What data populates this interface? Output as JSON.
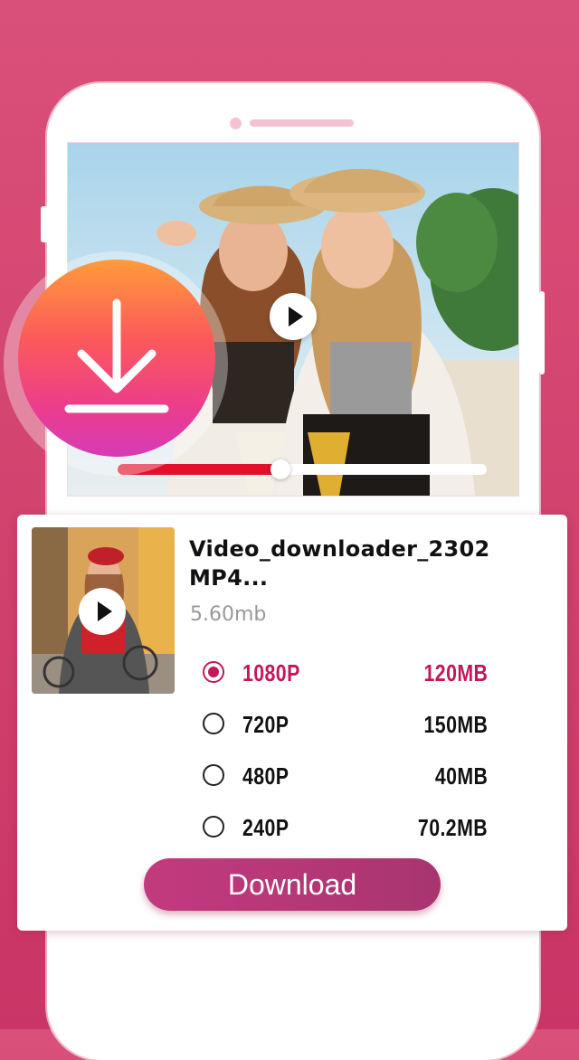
{
  "hero": {
    "download_icon": "download-arrow-icon",
    "play_icon": "play-icon",
    "progress_fraction": 0.44
  },
  "file": {
    "title": "Video_downloader_2302 MP4...",
    "size": "5.60mb"
  },
  "quality_options": [
    {
      "resolution": "1080P",
      "size": "120MB",
      "selected": true
    },
    {
      "resolution": "720P",
      "size": "150MB",
      "selected": false
    },
    {
      "resolution": "480P",
      "size": "40MB",
      "selected": false
    },
    {
      "resolution": "240P",
      "size": "70.2MB",
      "selected": false
    }
  ],
  "actions": {
    "download_label": "Download"
  },
  "colors": {
    "background": "#d2436e",
    "accent": "#c2185b",
    "progress": "#e3102b",
    "button": "#b8387a"
  }
}
